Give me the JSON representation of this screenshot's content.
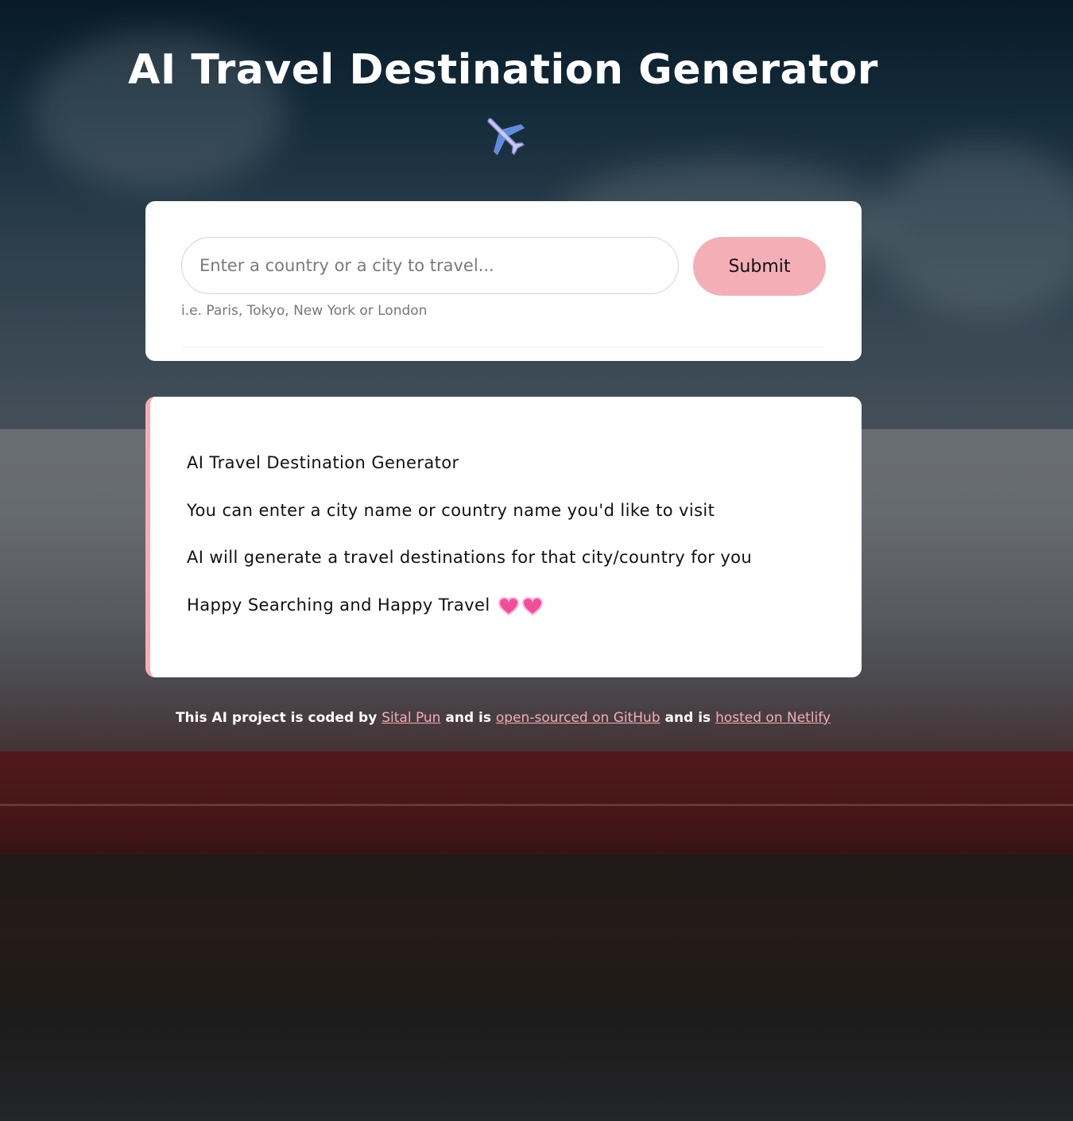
{
  "header": {
    "title": "AI Travel Destination Generator",
    "icon": "airplane-icon"
  },
  "search": {
    "placeholder": "Enter a country or a city to travel...",
    "value": "",
    "submit_label": "Submit",
    "hint": "i.e. Paris, Tokyo, New York or London"
  },
  "info": {
    "lines": [
      "AI Travel Destination Generator",
      "You can enter a city name or country name you'd like to visit",
      "AI will generate a travel destinations for that city/country for you",
      "Happy Searching and Happy Travel"
    ],
    "trailing_icons": [
      "heart-icon",
      "heart-icon"
    ]
  },
  "footer": {
    "text_1": "This AI project is coded by",
    "link_author": "Sital Pun",
    "text_2": "and is",
    "link_github": "open-sourced on GitHub",
    "text_3": "and is",
    "link_netlify": "hosted on Netlify"
  },
  "colors": {
    "accent": "#f3aeb6",
    "card": "#ffffff",
    "title": "#ffffff",
    "link": "#f3aeb6"
  }
}
